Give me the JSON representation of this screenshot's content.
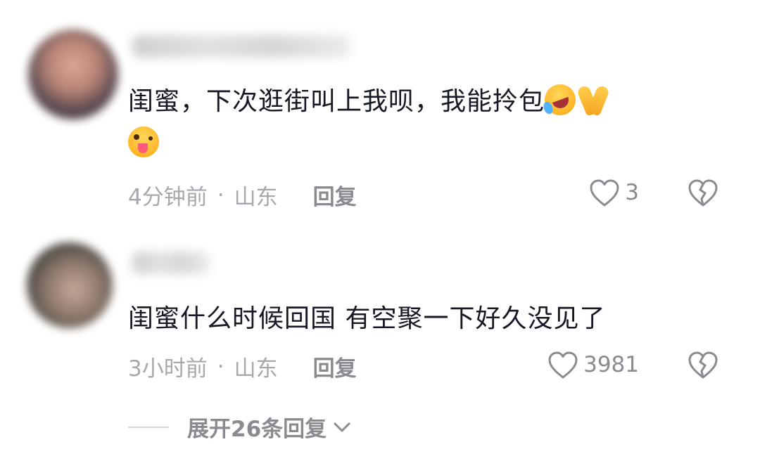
{
  "comments": [
    {
      "text": "闺蜜，下次逛街叫上我呗，我能拎包",
      "emojis": [
        "rolling-laugh-emoji",
        "folded-hands-emoji",
        "winking-tongue-emoji"
      ],
      "time": "4分钟前",
      "separator": "·",
      "location": "山东",
      "reply_label": "回复",
      "like_count": "3"
    },
    {
      "text": "闺蜜什么时候回国 有空聚一下好久没见了",
      "emojis": [],
      "time": "3小时前",
      "separator": "·",
      "location": "山东",
      "reply_label": "回复",
      "like_count": "3981"
    }
  ],
  "expand_label": "展开26条回复",
  "icons": {
    "like": "heart-outline-icon",
    "dislike": "broken-heart-icon",
    "expand": "chevron-down-icon"
  },
  "colors": {
    "text": "#161823",
    "meta": "#a7a8ad",
    "action": "#8a8b91"
  }
}
